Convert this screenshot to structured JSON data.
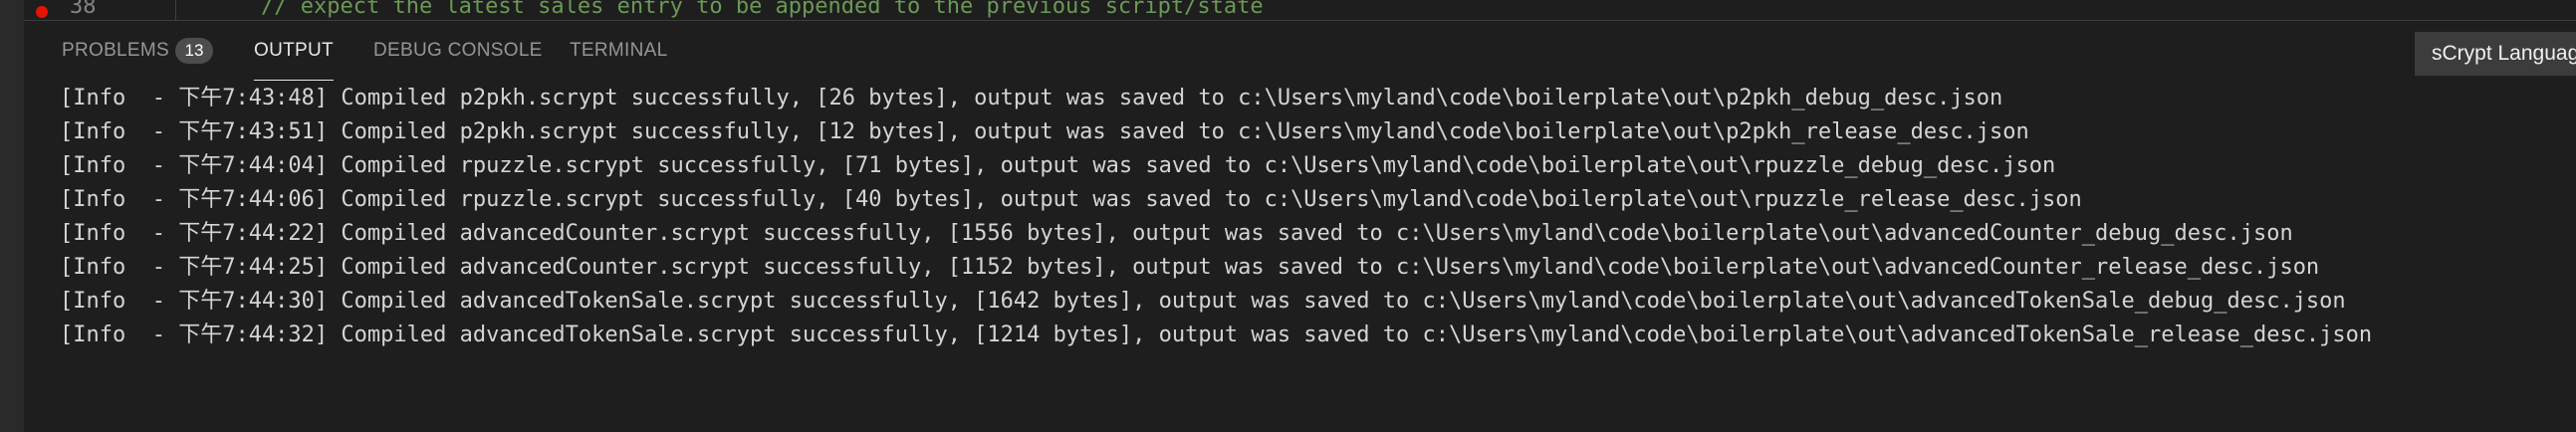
{
  "editor": {
    "line_number": "38",
    "code_text": "// expect the latest sales entry to be appended to the previous script/state"
  },
  "panel": {
    "tabs": [
      {
        "label": "PROBLEMS",
        "badge": "13",
        "active": false
      },
      {
        "label": "OUTPUT",
        "active": true
      },
      {
        "label": "DEBUG CONSOLE",
        "active": false
      },
      {
        "label": "TERMINAL",
        "active": false
      }
    ],
    "channel_select": "sCrypt Language"
  },
  "output": {
    "lines": [
      "[Info  - 下午7:43:48] Compiled p2pkh.scrypt successfully, [26 bytes], output was saved to c:\\Users\\myland\\code\\boilerplate\\out\\p2pkh_debug_desc.json",
      "[Info  - 下午7:43:51] Compiled p2pkh.scrypt successfully, [12 bytes], output was saved to c:\\Users\\myland\\code\\boilerplate\\out\\p2pkh_release_desc.json",
      "[Info  - 下午7:44:04] Compiled rpuzzle.scrypt successfully, [71 bytes], output was saved to c:\\Users\\myland\\code\\boilerplate\\out\\rpuzzle_debug_desc.json",
      "[Info  - 下午7:44:06] Compiled rpuzzle.scrypt successfully, [40 bytes], output was saved to c:\\Users\\myland\\code\\boilerplate\\out\\rpuzzle_release_desc.json",
      "[Info  - 下午7:44:22] Compiled advancedCounter.scrypt successfully, [1556 bytes], output was saved to c:\\Users\\myland\\code\\boilerplate\\out\\advancedCounter_debug_desc.json",
      "[Info  - 下午7:44:25] Compiled advancedCounter.scrypt successfully, [1152 bytes], output was saved to c:\\Users\\myland\\code\\boilerplate\\out\\advancedCounter_release_desc.json",
      "[Info  - 下午7:44:30] Compiled advancedTokenSale.scrypt successfully, [1642 bytes], output was saved to c:\\Users\\myland\\code\\boilerplate\\out\\advancedTokenSale_debug_desc.json",
      "[Info  - 下午7:44:32] Compiled advancedTokenSale.scrypt successfully, [1214 bytes], output was saved to c:\\Users\\myland\\code\\boilerplate\\out\\advancedTokenSale_release_desc.json"
    ]
  },
  "colors": {
    "background": "#1e1e1e",
    "text": "#d4d4d4",
    "tab_inactive": "#969696",
    "tab_active": "#e7e7e7",
    "badge_bg": "#4d4d4d",
    "breakpoint": "#e51400",
    "comment": "#6a9955"
  }
}
